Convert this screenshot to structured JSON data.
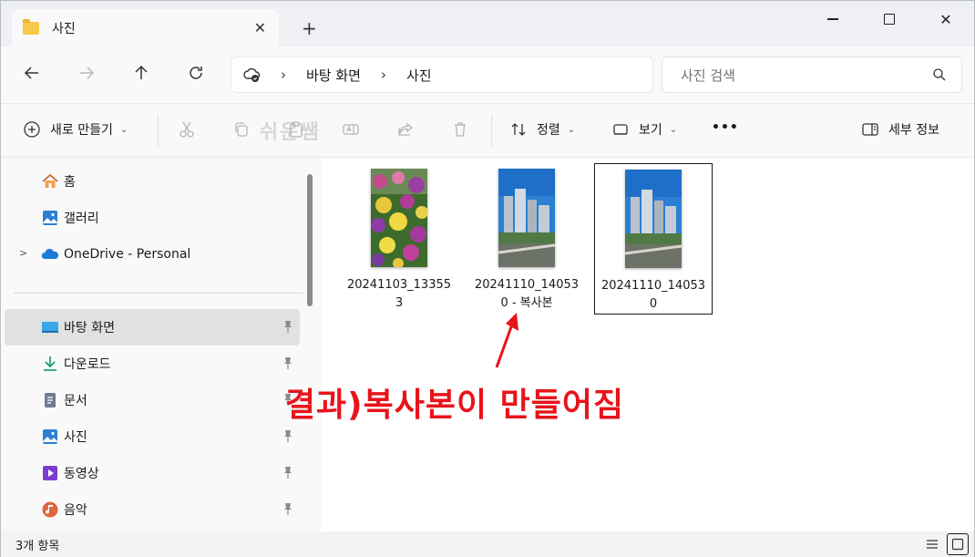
{
  "tab": {
    "title": "사진",
    "close": "✕",
    "new": "+"
  },
  "window": {
    "minimize": "",
    "close": "✕"
  },
  "address": {
    "crumbs": [
      "바탕 화면",
      "사진"
    ],
    "separator": "›"
  },
  "search": {
    "placeholder": "사진 검색"
  },
  "toolbar": {
    "new_label": "새로 만들기",
    "sort_label": "정렬",
    "view_label": "보기",
    "more_label": "•••",
    "details_label": "세부 정보",
    "watermark": "쉬운쌤"
  },
  "sidebar": {
    "items": [
      {
        "label": "홈",
        "icon": "home-icon"
      },
      {
        "label": "갤러리",
        "icon": "gallery-icon"
      },
      {
        "label": "OneDrive - Personal",
        "icon": "onedrive-icon"
      },
      {
        "label": "바탕 화면",
        "icon": "desktop-icon",
        "pinned": true,
        "selected": true
      },
      {
        "label": "다운로드",
        "icon": "download-icon",
        "pinned": true
      },
      {
        "label": "문서",
        "icon": "document-icon",
        "pinned": true
      },
      {
        "label": "사진",
        "icon": "pictures-icon",
        "pinned": true
      },
      {
        "label": "동영상",
        "icon": "video-icon",
        "pinned": true
      },
      {
        "label": "음악",
        "icon": "music-icon",
        "pinned": true
      }
    ]
  },
  "files": [
    {
      "name": "20241103_133553",
      "thumb": "flowers"
    },
    {
      "name": "20241110_140530 - 복사본",
      "thumb": "city"
    },
    {
      "name": "20241110_140530",
      "thumb": "city",
      "selected": true
    }
  ],
  "annotation": {
    "text": "결과)복사본이 만들어짐",
    "color": "#e8141b"
  },
  "status": {
    "count": "3개 항목"
  },
  "colors": {
    "accent": "#0067c0",
    "annotation": "#e8141b",
    "selection": "#e1e1e1"
  }
}
